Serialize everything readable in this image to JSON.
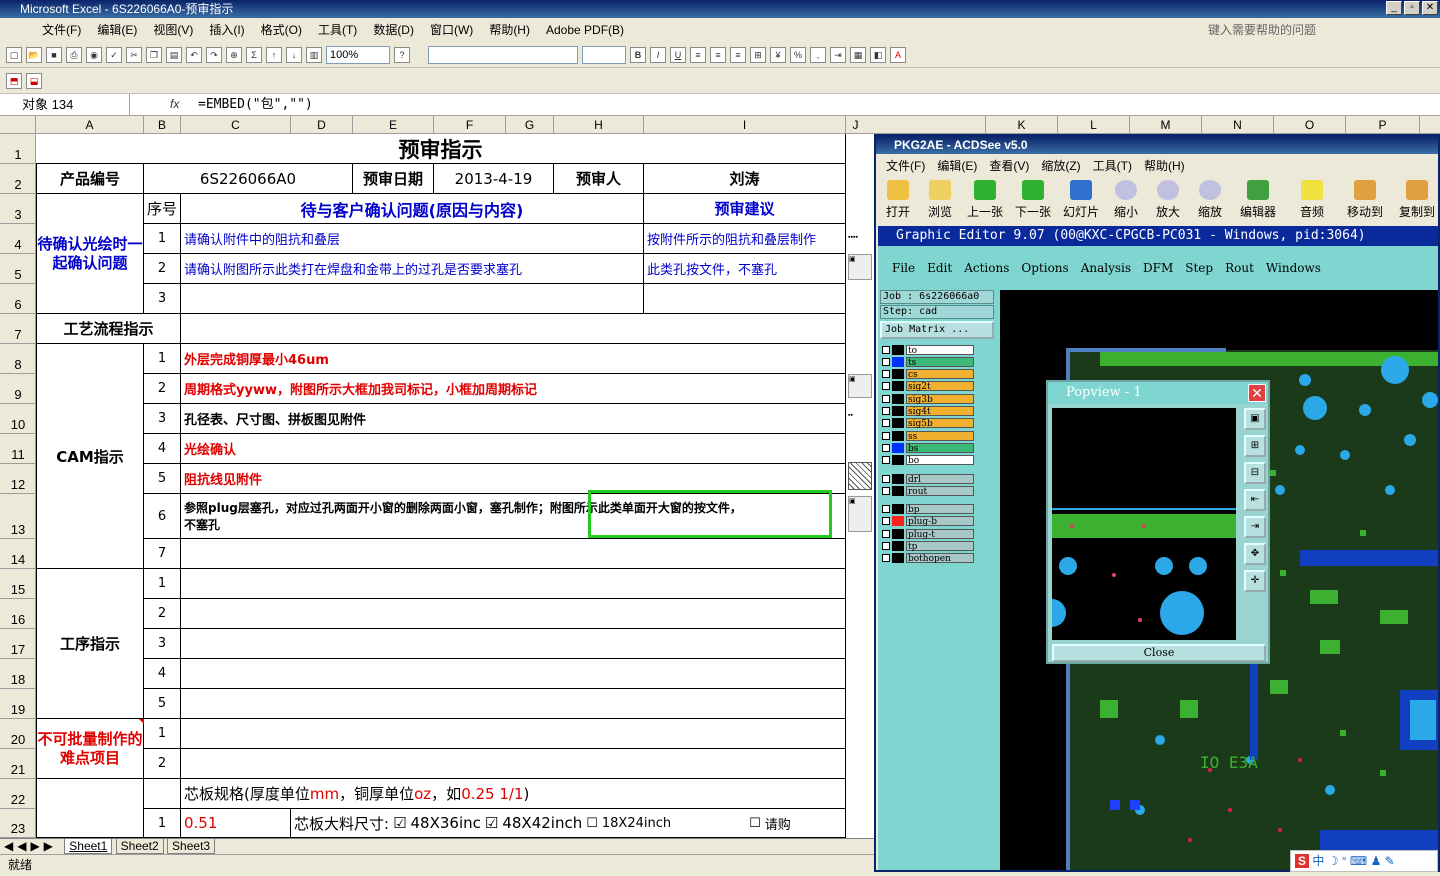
{
  "excel": {
    "title": "Microsoft Excel - 6S226066A0-预审指示",
    "menu": [
      "文件(F)",
      "编辑(E)",
      "视图(V)",
      "插入(I)",
      "格式(O)",
      "工具(T)",
      "数据(D)",
      "窗口(W)",
      "帮助(H)",
      "Adobe PDF(B)"
    ],
    "help_placeholder": "键入需要帮助的问题",
    "zoom": "100%",
    "name_box": "对象 134",
    "fx_label": "fx",
    "formula": "=EMBED(\"包\",\"\")",
    "columns": [
      "A",
      "B",
      "C",
      "D",
      "E",
      "F",
      "G",
      "H",
      "I",
      "J",
      "K",
      "L",
      "M",
      "N",
      "O",
      "P"
    ],
    "rows": [
      "1",
      "2",
      "3",
      "4",
      "5",
      "6",
      "7",
      "8",
      "9",
      "10",
      "11",
      "12",
      "13",
      "14",
      "15",
      "16",
      "17",
      "18",
      "19",
      "20",
      "21",
      "22",
      "23"
    ],
    "sheet_tabs": [
      "Sheet1",
      "Sheet2",
      "Sheet3"
    ],
    "status": "就绪"
  },
  "sheet": {
    "title": "预审指示",
    "product_no_label": "产品编号",
    "product_no": "6S226066A0",
    "review_date_label": "预审日期",
    "review_date": "2013-4-19",
    "reviewer_label": "预审人",
    "reviewer": "刘涛",
    "seq_label": "序号",
    "issues_header": "待与客户确认问题(原因与内容)",
    "advice_header": "预审建议",
    "confirm_section": "待确认光绘时一起确认问题",
    "confirm_items": [
      {
        "no": "1",
        "issue": "请确认附件中的阻抗和叠层",
        "advice": "按附件所示的阻抗和叠层制作"
      },
      {
        "no": "2",
        "issue": "请确认附图所示此类打在焊盘和金带上的过孔是否要求塞孔",
        "advice": "此类孔按文件，不塞孔"
      },
      {
        "no": "3",
        "issue": "",
        "advice": ""
      }
    ],
    "process_label": "工艺流程指示",
    "cam_label": "CAM指示",
    "cam_items": [
      {
        "no": "1",
        "text": "外层完成铜厚最小46um",
        "color": "red"
      },
      {
        "no": "2",
        "text": "周期格式yyww，附图所示大框加我司标记，小框加周期标记",
        "color": "red"
      },
      {
        "no": "3",
        "text": "孔径表、尺寸图、拼板图见附件",
        "color": "black"
      },
      {
        "no": "4",
        "text": "光绘确认",
        "color": "red"
      },
      {
        "no": "5",
        "text": "阻抗线见附件",
        "color": "red"
      },
      {
        "no": "6",
        "text": "参照plug层塞孔，对应过孔两面开小窗的删除两面小窗，塞孔制作；附图所示此类单面开大窗的按文件，",
        "text2": "不塞孔",
        "color": "black"
      },
      {
        "no": "7",
        "text": "",
        "color": "black"
      }
    ],
    "process_step_label": "工序指示",
    "process_steps": [
      "1",
      "2",
      "3",
      "4",
      "5"
    ],
    "difficult_label": "不可批量制作的难点项目",
    "difficult_items": [
      "1",
      "2"
    ],
    "core_spec": "芯板规格(厚度单位mm, 铜厚单位oz, 如0.25 1/1)",
    "core_spec_parts": {
      "a": "芯板规格(厚度单位",
      "b": "mm",
      "c": "，铜厚单位",
      "d": "oz",
      "e": "，如",
      "f": "0.25 1/1",
      "g": ")"
    },
    "core_row_no": "1",
    "core_value": "0.51",
    "core_size_label": "芯板大料尺寸:",
    "core_size_1": "48X36inc",
    "core_size_2": "48X42inch",
    "core_size_3": "18X24inch",
    "core_size_4": "请购"
  },
  "acdsee": {
    "title": "PKG2AE - ACDSee v5.0",
    "menu": [
      "文件(F)",
      "编辑(E)",
      "查看(V)",
      "缩放(Z)",
      "工具(T)",
      "帮助(H)"
    ],
    "tools": [
      "打开",
      "浏览",
      "上一张",
      "下一张",
      "幻灯片",
      "缩小",
      "放大",
      "缩放",
      "编辑器",
      "音频",
      "移动到",
      "复制到"
    ]
  },
  "graphic_editor": {
    "title": "Graphic Editor 9.07 (00@KXC-CPGCB-PC031 - Windows, pid:3064)",
    "menu": [
      "File",
      "Edit",
      "Actions",
      "Options",
      "Analysis",
      "DFM",
      "Step",
      "Rout",
      "Windows"
    ],
    "job": "Job : 6s226066a0",
    "step": "Step: cad",
    "job_matrix": "Job Matrix ...",
    "layers": [
      {
        "name": "to",
        "color": "#ffffff",
        "swatch": "#000000"
      },
      {
        "name": "ts",
        "color": "#3cb878",
        "swatch": "#0030ff"
      },
      {
        "name": "cs",
        "color": "#f0b030",
        "swatch": "#000000"
      },
      {
        "name": "sig2t",
        "color": "#f0b030",
        "swatch": "#000000"
      },
      {
        "name": "sig3b",
        "color": "#f0b030",
        "swatch": "#000000"
      },
      {
        "name": "sig4t",
        "color": "#f0b030",
        "swatch": "#000000"
      },
      {
        "name": "sig5b",
        "color": "#f0b030",
        "swatch": "#000000"
      },
      {
        "name": "ss",
        "color": "#f0b030",
        "swatch": "#000000"
      },
      {
        "name": "bs",
        "color": "#3cb878",
        "swatch": "#0030ff"
      },
      {
        "name": "bo",
        "color": "#ffffff",
        "swatch": "#000000"
      },
      {
        "name": "drl",
        "color": "#a8c8c8",
        "swatch": "#000000"
      },
      {
        "name": "rout",
        "color": "#a8c8c8",
        "swatch": "#000000"
      },
      {
        "name": "bp",
        "color": "#a8c8c8",
        "swatch": "#000000"
      },
      {
        "name": "plug-b",
        "color": "#a8c8c8",
        "swatch": "#ff2020"
      },
      {
        "name": "plug-t",
        "color": "#a8c8c8",
        "swatch": "#000000"
      },
      {
        "name": "tp",
        "color": "#a8c8c8",
        "swatch": "#000000"
      },
      {
        "name": "bothopen",
        "color": "#a8c8c8",
        "swatch": "#000000"
      }
    ],
    "canvas_text": "IO E3A",
    "popview_title": "Popview - 1",
    "popview_close": "Close"
  },
  "ime": "中 ☽ ° ⌨ ♟ ✎",
  "ime_logo": "S",
  "colors": {
    "accent": "#0a246a",
    "green_highlight": "#22cc22",
    "pcb_green": "#3cb030",
    "pcb_blue": "#2aa8e8"
  }
}
